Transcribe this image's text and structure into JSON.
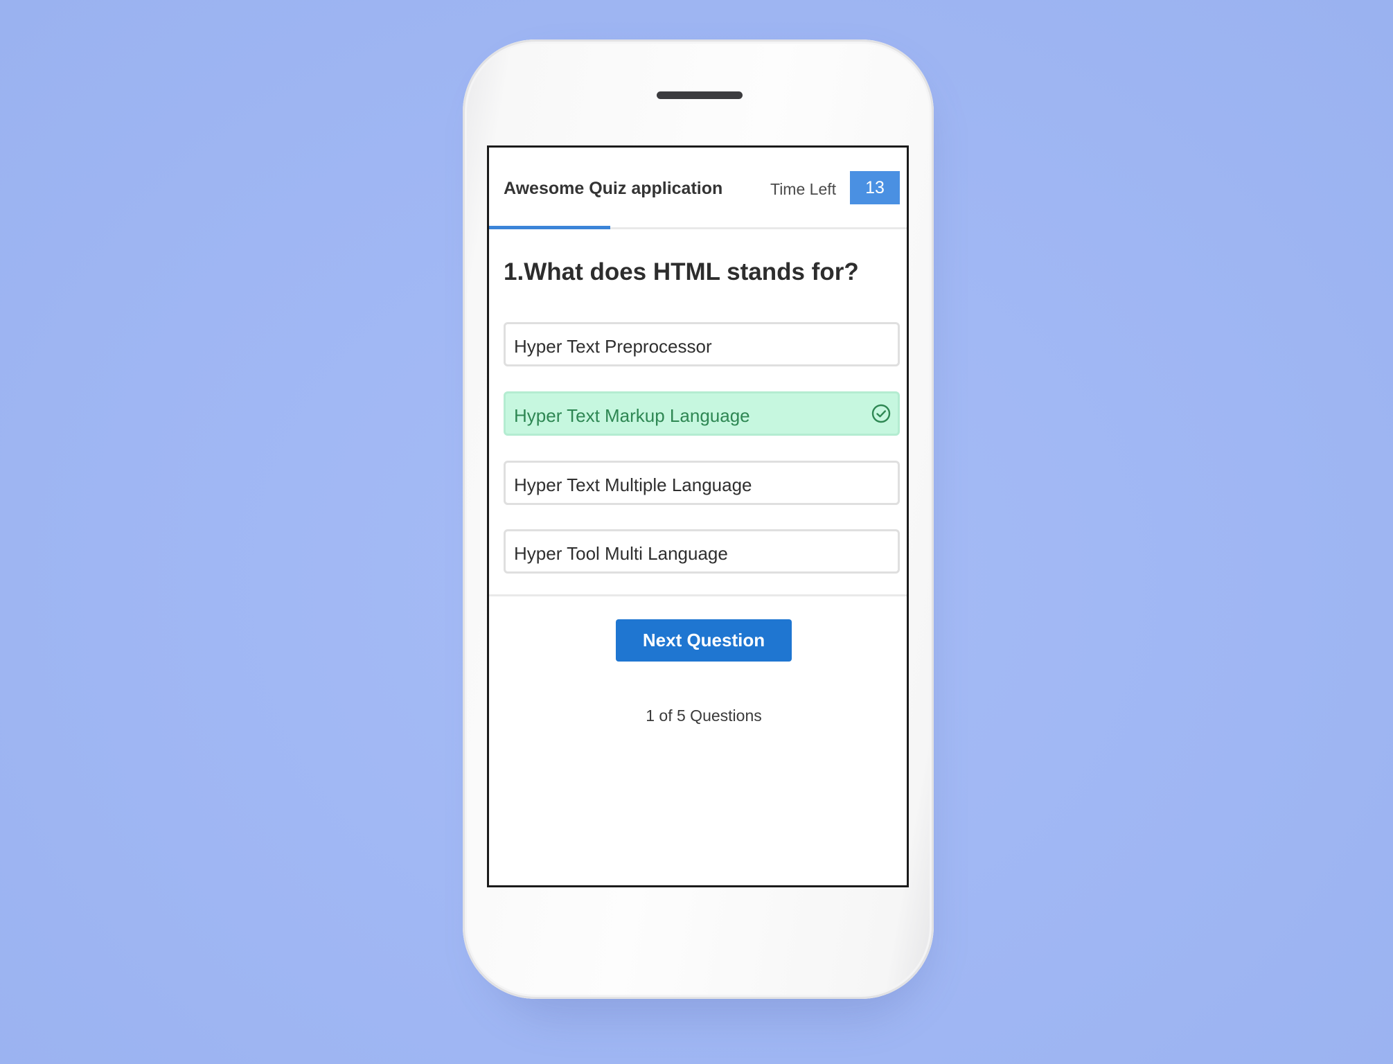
{
  "header": {
    "title": "Awesome Quiz application",
    "time_left_label": "Time Left",
    "time_left_value": "13",
    "time_progress_fraction": 0.29
  },
  "question": {
    "text": "1.What does HTML stands for?"
  },
  "options": [
    {
      "label": "Hyper Text Preprocessor",
      "state": "default"
    },
    {
      "label": "Hyper Text Markup Language",
      "state": "correct"
    },
    {
      "label": "Hyper Text Multiple Language",
      "state": "default"
    },
    {
      "label": "Hyper Tool Multi Language",
      "state": "default"
    }
  ],
  "footer": {
    "next_label": "Next Question",
    "count_text": "1 of 5 Questions"
  },
  "colors": {
    "background": "#a1b8f4",
    "accent": "#1f76d1",
    "timer": "#4a90e2",
    "correct_bg": "#c6f7df",
    "correct_text": "#2e8753"
  },
  "icons": {
    "correct_option": "check-circle-icon"
  }
}
